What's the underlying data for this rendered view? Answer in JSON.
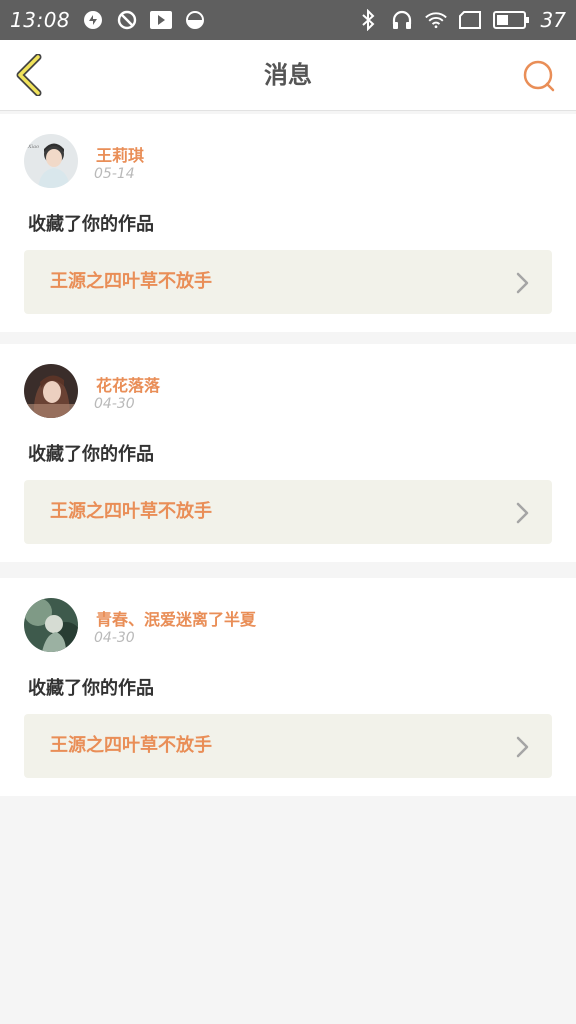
{
  "status_bar": {
    "time": "13:08",
    "battery_level": "37",
    "icons": [
      "sync-icon",
      "block-icon",
      "play-icon",
      "data-saver-icon",
      "bluetooth-icon",
      "headphones-icon",
      "wifi-icon",
      "sim-icon",
      "battery-icon"
    ]
  },
  "header": {
    "title": "消息",
    "back_icon": "chevron-left-icon",
    "search_icon": "search-icon"
  },
  "colors": {
    "accent": "#e98e57",
    "back_arrow_fill": "#f1e35a",
    "work_bg": "#f2f2ea",
    "status_bar_bg": "#5f5f5f"
  },
  "messages": [
    {
      "user": "王莉琪",
      "date": "05-14",
      "action": "收藏了你的作品",
      "work_title": "王源之四叶草不放手"
    },
    {
      "user": "花花落落",
      "date": "04-30",
      "action": "收藏了你的作品",
      "work_title": "王源之四叶草不放手"
    },
    {
      "user": "青春、泯爱迷离了半夏",
      "date": "04-30",
      "action": "收藏了你的作品",
      "work_title": "王源之四叶草不放手"
    }
  ]
}
